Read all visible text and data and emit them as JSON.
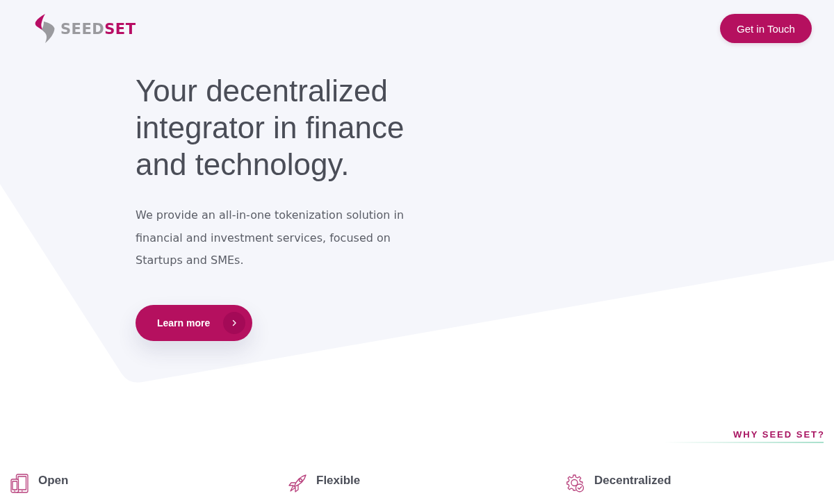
{
  "header": {
    "logo": {
      "first": "SEED",
      "second": "SET"
    },
    "contact_button": "Get in Touch"
  },
  "hero": {
    "heading": "Your decentralized integrator in finance and technology.",
    "text": "We provide an all-in-one tokenization solution in financial and investment services, focused on Startups and SMEs.",
    "button": "Learn more"
  },
  "why": {
    "label": "WHY SEED SET?"
  },
  "features": [
    {
      "kind": "devices",
      "title": "Open"
    },
    {
      "kind": "rocket",
      "title": "Flexible"
    },
    {
      "kind": "gear-check",
      "title": "Decentralized"
    }
  ]
}
